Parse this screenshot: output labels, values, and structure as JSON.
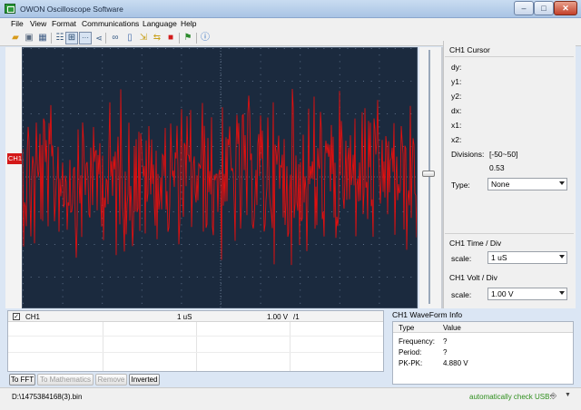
{
  "window": {
    "title": "OWON Oscilloscope Software"
  },
  "menu": [
    "File",
    "View",
    "Format",
    "Communications",
    "Language",
    "Help"
  ],
  "toolbar_icons": [
    "open-icon",
    "print-icon",
    "save-icon",
    "table-icon",
    "grid-icon",
    "dots-icon",
    "share-icon",
    "link-icon",
    "phone-icon",
    "export-icon",
    "swap-icon",
    "stop-icon",
    "flag-icon",
    "help-icon"
  ],
  "scope": {
    "channel_marker": "CH1",
    "trace_color": "#e01010",
    "background": "#1b2a3e"
  },
  "cursor": {
    "title": "CH1 Cursor",
    "dy_label": "dy:",
    "y1_label": "y1:",
    "y2_label": "y2:",
    "dx_label": "dx:",
    "x1_label": "x1:",
    "x2_label": "x2:",
    "divisions_label": "Divisions:",
    "divisions_range": "[-50~50]",
    "divisions_value": "0.53",
    "type_label": "Type:",
    "type_value": "None"
  },
  "time_div": {
    "title": "CH1 Time / Div",
    "scale_label": "scale:",
    "scale_value": "1  uS"
  },
  "volt_div": {
    "title": "CH1 Volt / Div",
    "scale_label": "scale:",
    "scale_value": "1.00 V"
  },
  "channels": {
    "rows": [
      {
        "name": "CH1",
        "time": "1  uS",
        "volt": "1.00 V",
        "ratio": "/1",
        "checked": "✓"
      }
    ]
  },
  "buttons": {
    "fft": "To FFT",
    "math": "To Mathematics",
    "remove": "Remove",
    "inverted": "Inverted"
  },
  "waveform_info": {
    "title": "CH1 WaveForm Info",
    "headers": [
      "Type",
      "Value"
    ],
    "rows": [
      {
        "type": "Frequency:",
        "value": "?"
      },
      {
        "type": "Period:",
        "value": "?"
      },
      {
        "type": "PK-PK:",
        "value": "4.880 V"
      }
    ]
  },
  "status": {
    "file": "D:\\1475384168(3).bin",
    "usb": "automatically check USB:"
  }
}
